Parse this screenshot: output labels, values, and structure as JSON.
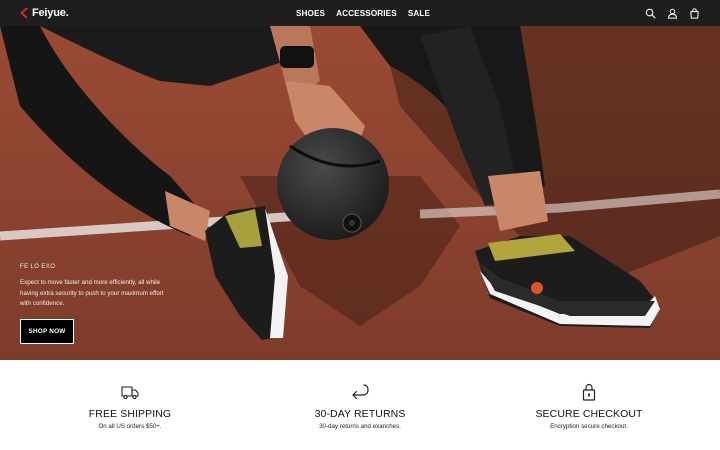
{
  "header": {
    "logo_text": "Feiyue.",
    "brand_color": "#d7262b",
    "nav": [
      {
        "label": "SHOES"
      },
      {
        "label": "ACCESSORIES"
      },
      {
        "label": "SALE"
      }
    ],
    "icons": [
      "search-icon",
      "account-icon",
      "cart-icon"
    ]
  },
  "hero": {
    "kicker": "FE LO EXO",
    "description": "Expect to move faster and more efficiently, all while having extra security to push to your maximum effort with confidence.",
    "cta_label": "SHOP NOW"
  },
  "features": [
    {
      "icon": "truck-icon",
      "title": "FREE SHIPPING",
      "subtitle": "On all US orders $50+."
    },
    {
      "icon": "return-arrow-icon",
      "title": "30-DAY RETURNS",
      "subtitle": "30-day returns and exanches."
    },
    {
      "icon": "lock-icon",
      "title": "SECURE CHECKOUT",
      "subtitle": "Encryption secure checkout."
    }
  ]
}
